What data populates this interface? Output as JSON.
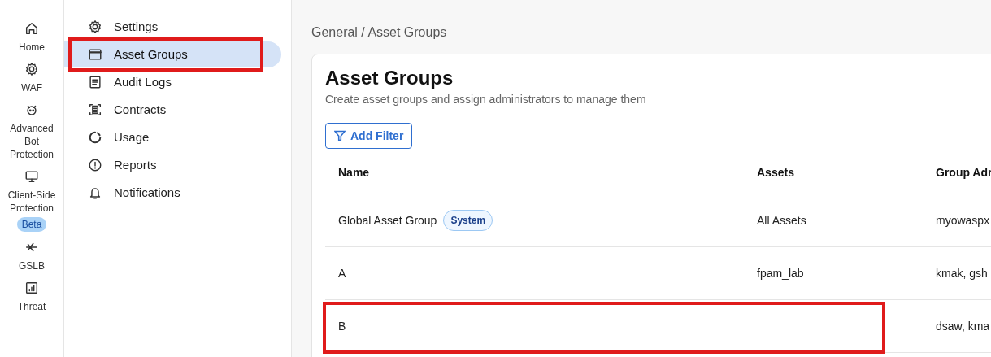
{
  "rail": [
    {
      "kind": "home",
      "label": "Home"
    },
    {
      "kind": "gear",
      "label": "WAF"
    },
    {
      "kind": "bot",
      "label": "Advanced Bot Protection"
    },
    {
      "kind": "monitor",
      "label": "Client-Side Protection",
      "badge": "Beta"
    },
    {
      "kind": "network",
      "label": "GSLB"
    },
    {
      "kind": "chart",
      "label": "Threat"
    }
  ],
  "menu": [
    {
      "kind": "gear",
      "label": "Settings",
      "selected": false,
      "annotated": false
    },
    {
      "kind": "window",
      "label": "Asset Groups",
      "selected": true,
      "annotated": true
    },
    {
      "kind": "doc",
      "label": "Audit Logs",
      "selected": false,
      "annotated": false
    },
    {
      "kind": "contract",
      "label": "Contracts",
      "selected": false,
      "annotated": false
    },
    {
      "kind": "ring",
      "label": "Usage",
      "selected": false,
      "annotated": false
    },
    {
      "kind": "alert",
      "label": "Reports",
      "selected": false,
      "annotated": false
    },
    {
      "kind": "bell",
      "label": "Notifications",
      "selected": false,
      "annotated": false
    }
  ],
  "breadcrumb": "General / Asset Groups",
  "page": {
    "title": "Asset Groups",
    "subtitle": "Create asset groups and assign administrators to manage them",
    "filter_button": "Add Filter"
  },
  "table": {
    "columns": [
      "Name",
      "Assets",
      "Group Adr"
    ],
    "rows": [
      {
        "name": "Global Asset Group",
        "tag": "System",
        "assets": "All Assets",
        "admins": "myowaspx",
        "annotated": false
      },
      {
        "name": "A",
        "assets": "fpam_lab",
        "admins": "kmak, gsh",
        "annotated": false
      },
      {
        "name": "B",
        "assets": "",
        "admins": "dsaw, kma",
        "annotated": true
      }
    ]
  }
}
